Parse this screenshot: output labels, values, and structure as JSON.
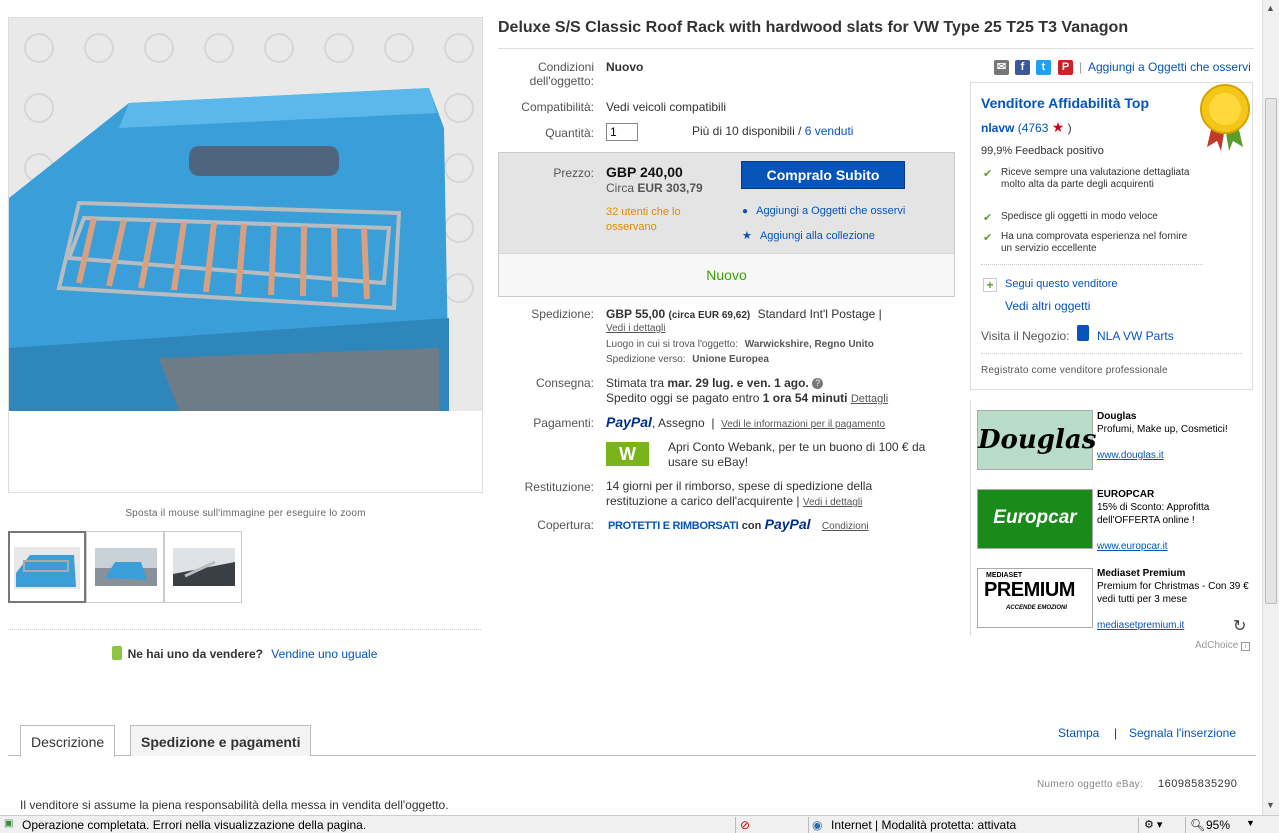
{
  "item": {
    "title": "Deluxe S/S Classic Roof Rack with hardwood slats for VW Type 25 T25 T3 Vanagon",
    "zoom_hint": "Sposta il mouse sull'immagine per eseguire lo zoom",
    "sell_question": "Ne hai uno da vendere?",
    "sell_link": "Vendine uno uguale"
  },
  "details": {
    "condition_label": "Condizioni dell'oggetto:",
    "condition_value": "Nuovo",
    "compat_label": "Compatibilità:",
    "compat_link": "Vedi veicoli compatibili",
    "qty_label": "Quantità:",
    "qty_value": "1",
    "available": "Più di 10 disponibili",
    "sold_link": "6 venduti"
  },
  "price": {
    "label": "Prezzo:",
    "value": "GBP 240,00",
    "approx_prefix": "Circa",
    "approx_value": "EUR 303,79",
    "buy_button": "Compralo Subito",
    "watchers": "32 utenti che lo osservano",
    "watch_link": "Aggiungi a Oggetti che osservi",
    "collection_link": "Aggiungi alla collezione",
    "condition_badge": "Nuovo"
  },
  "shipping": {
    "label": "Spedizione:",
    "cost": "GBP 55,00",
    "cost_approx": "(circa EUR 69,62)",
    "service": "Standard Int'l Postage |",
    "details_link": "Vedi i dettagli",
    "location_label": "Luogo in cui si trova l'oggetto:",
    "location": "Warwickshire, Regno Unito",
    "ships_to_label": "Spedizione verso:",
    "ships_to": "Unione Europea"
  },
  "delivery": {
    "label": "Consegna:",
    "estimated_prefix": "Stimata tra",
    "estimated_range": "mar. 29 lug. e ven. 1 ago.",
    "cutoff_prefix": "Spedito oggi se pagato entro",
    "cutoff_time": "1 ora 54 minuti",
    "details_link": "Dettagli"
  },
  "payments": {
    "label": "Pagamenti:",
    "paypal": "PayPal",
    "method2": ", Assegno",
    "info_link": "Vedi le informazioni per il pagamento",
    "webank_logo": "W",
    "webank_text": "Apri Conto Webank, per te un buono di 100 € da usare su eBay!"
  },
  "returns": {
    "label": "Restituzione:",
    "text": "14 giorni per il rimborso, spese di spedizione della restituzione a carico dell'acquirente |",
    "details_link": "Vedi i dettagli"
  },
  "coverage": {
    "label": "Copertura:",
    "text": "PROTETTI E RIMBORSATI",
    "con": "con",
    "paypal": "PayPal",
    "link": "Condizioni"
  },
  "share": {
    "watch_link": "Aggiungi a Oggetti che osservi"
  },
  "seller": {
    "badge_title": "Venditore Affidabilità Top",
    "name": "nlavw",
    "score": "(4763",
    "score_close": ")",
    "feedback": "99,9% Feedback positivo",
    "perks": [
      "Riceve sempre una valutazione dettagliata molto alta da parte degli acquirenti",
      "Spedisce gli oggetti in modo veloce",
      "Ha una comprovata esperienza nel fornire un servizio eccellente"
    ],
    "follow_link": "Segui questo venditore",
    "other_items_link": "Vedi altri oggetti",
    "store_label": "Visita il Negozio:",
    "store_name": "NLA VW Parts",
    "registered": "Registrato come venditore professionale"
  },
  "ads": [
    {
      "logo": "Douglas",
      "name": "Douglas",
      "desc": "Profumi, Make up, Cosmetici!",
      "url": "www.douglas.it"
    },
    {
      "logo": "Europcar",
      "name": "EUROPCAR",
      "desc": "15% di Sconto: Approfitta dell'OFFERTA online !",
      "url": "www.europcar.it"
    },
    {
      "logo": "PREMIUM",
      "logo_top": "MEDIASET",
      "logo_sub": "ACCENDE EMOZIONI",
      "name": "Mediaset Premium",
      "desc": "Premium for Christmas - Con 39 € vedi tutti per 3 mese",
      "url": "mediasetpremium.it"
    }
  ],
  "adchoice": "AdChoice",
  "tabs": [
    "Descrizione",
    "Spedizione e pagamenti"
  ],
  "actions": {
    "print": "Stampa",
    "separator": "|",
    "report": "Segnala l'inserzione"
  },
  "item_number_label": "Numero oggetto eBay:",
  "item_number": "160985835290",
  "description_start": "Il venditore si assume la piena responsabilità della messa in vendita dell'oggetto.",
  "statusbar": {
    "message": "Operazione completata. Errori nella visualizzazione della pagina.",
    "zone": "Internet | Modalità protetta: attivata",
    "zoom": "95%"
  },
  "colors": {
    "link": "#0654ba",
    "buy_button": "#0654ba",
    "new_green": "#39a000",
    "watchers_orange": "#e08a00"
  }
}
